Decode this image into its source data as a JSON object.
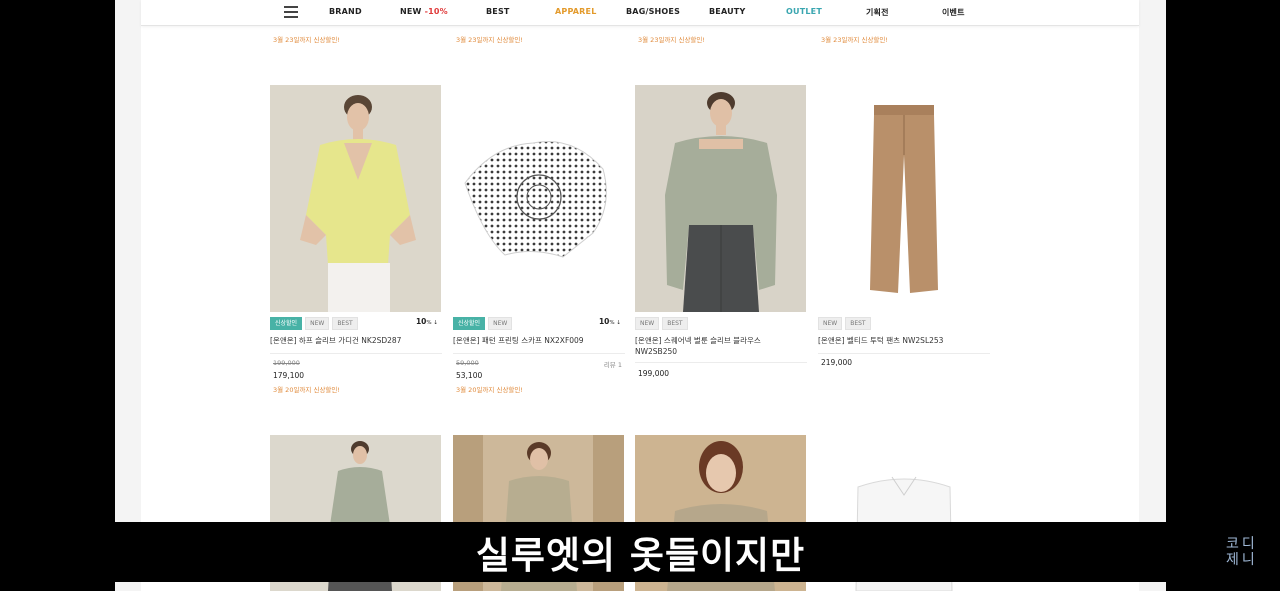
{
  "nav": {
    "brand": "BRAND",
    "new": "NEW",
    "new_sale": "-10%",
    "best": "BEST",
    "apparel": "APPAREL",
    "bag_shoes": "BAG/SHOES",
    "beauty": "BEAUTY",
    "outlet": "OUTLET",
    "special": "기획전",
    "event": "이벤트"
  },
  "top_row": {
    "notes": [
      "3월 23일까지 신상할인!",
      "3월 23일까지 신상할인!",
      "3월 23일까지 신상할인!",
      "3월 23일까지 신상할인!"
    ]
  },
  "products": [
    {
      "badges": [
        "신상할인",
        "NEW",
        "BEST"
      ],
      "discount": "10",
      "discount_unit": "% ↓",
      "name": "[온앤온] 하프 슬리브 가디건 NK2SD287",
      "original_price": "199,000",
      "review": "",
      "price": "179,100",
      "note": "3월 20일까지 신상할인!"
    },
    {
      "badges": [
        "신상할인",
        "NEW"
      ],
      "discount": "10",
      "discount_unit": "% ↓",
      "name": "[온앤온] 패턴 프린팅 스카프 NX2XF009",
      "original_price": "59,000",
      "review": "리뷰 1",
      "price": "53,100",
      "note": "3월 20일까지 신상할인!"
    },
    {
      "badges": [
        "NEW",
        "BEST"
      ],
      "discount": "",
      "discount_unit": "",
      "name": "[온앤온] 스퀘어넥 벌룬 슬리브 블라우스 NW2SB250",
      "original_price": "",
      "review": "",
      "price": "199,000",
      "note": ""
    },
    {
      "badges": [
        "NEW",
        "BEST"
      ],
      "discount": "",
      "discount_unit": "",
      "name": "[온앤온] 벨티드 투턱 팬츠 NW2SL253",
      "original_price": "",
      "review": "",
      "price": "219,000",
      "note": ""
    }
  ],
  "caption": "실루엣의 옷들이지만",
  "watermark": {
    "line1": "코디",
    "line2": "제니"
  },
  "colors": {
    "apparel": "#e39a2b",
    "outlet": "#3aa6b0",
    "sale_badge": "#48b2a6",
    "event_note": "#e08a3b",
    "new_sale": "#e03b3b"
  }
}
